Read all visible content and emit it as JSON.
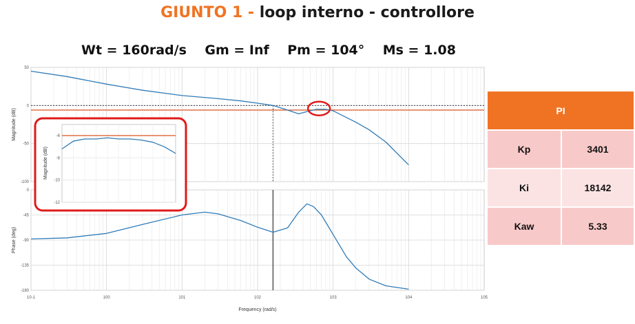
{
  "header": {
    "title_accent": "GIUNTO 1 -",
    "title_rest": " loop interno - controllore",
    "subtitle": "Wt = 160rad/s    Gm = Inf    Pm = 104°    Ms = 1.08"
  },
  "colors": {
    "accent": "#f07323",
    "line": "#2e7bb8",
    "ref": "#d9541e",
    "highlight": "#e01919"
  },
  "table": {
    "header": "PI",
    "rows": [
      {
        "key": "Kp",
        "value": "3401"
      },
      {
        "key": "Ki",
        "value": "18142"
      },
      {
        "key": "Kaw",
        "value": "5.33"
      }
    ]
  },
  "chart_data": [
    {
      "type": "line",
      "ylabel": "Magnitude (dB)",
      "xscale": "log",
      "xlim": [
        0.1,
        10000
      ],
      "ylim": [
        -100,
        50
      ],
      "yticks": [
        50,
        0,
        -50,
        -100
      ],
      "grid": true,
      "series": [
        {
          "x": [
            0.1,
            0.3,
            1,
            3,
            10,
            30,
            60,
            100,
            160,
            250,
            350,
            450,
            600,
            800,
            1000,
            2000,
            3000,
            5000,
            10000
          ],
          "y": [
            45,
            38,
            28,
            20,
            13,
            9,
            6,
            3,
            0,
            -6,
            -11,
            -8,
            -5,
            -5,
            -7,
            -22,
            -32,
            -48,
            -78
          ]
        }
      ],
      "reference_lines": [
        0,
        -6
      ]
    },
    {
      "type": "line",
      "xlabel": "Frequency  (rad/s)",
      "ylabel": "Phase (deg)",
      "xscale": "log",
      "xlim": [
        0.1,
        10000
      ],
      "ylim": [
        -180,
        0
      ],
      "yticks": [
        0,
        -45,
        -90,
        -135,
        -180
      ],
      "xticks": [
        "10^-1",
        "10^0",
        "10^1",
        "10^2",
        "10^3",
        "10^4",
        "10^5"
      ],
      "grid": true,
      "series": [
        {
          "x": [
            0.1,
            0.3,
            1,
            3,
            10,
            20,
            30,
            60,
            100,
            160,
            250,
            350,
            450,
            550,
            700,
            1000,
            1500,
            2000,
            3000,
            5000,
            10000
          ],
          "y": [
            -88,
            -86,
            -78,
            -62,
            -45,
            -40,
            -43,
            -55,
            -67,
            -76,
            -68,
            -40,
            -25,
            -30,
            -45,
            -80,
            -120,
            -140,
            -160,
            -172,
            -178
          ]
        }
      ]
    },
    {
      "type": "line",
      "ylabel": "Magnitude (dB)",
      "ylim": [
        -12,
        -5
      ],
      "yticks": [
        -6,
        -8,
        -10,
        -12
      ],
      "series": [
        {
          "x": [
            0,
            1,
            2,
            3,
            4,
            5,
            6,
            7,
            8,
            9,
            10
          ],
          "y": [
            -7.2,
            -6.5,
            -6.3,
            -6.3,
            -6.2,
            -6.3,
            -6.3,
            -6.4,
            -6.6,
            -7.0,
            -7.6
          ]
        }
      ],
      "reference_lines": [
        -6
      ]
    }
  ]
}
